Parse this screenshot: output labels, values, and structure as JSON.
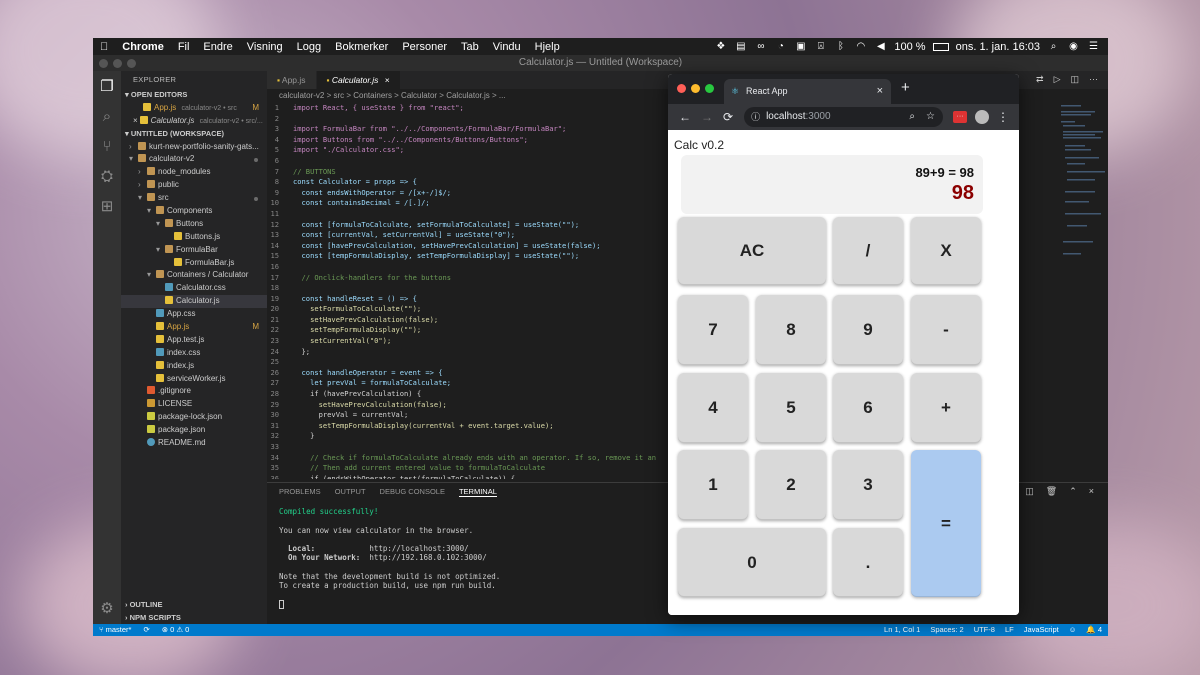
{
  "menubar": {
    "apple": "",
    "app": "Chrome",
    "items": [
      "Fil",
      "Endre",
      "Visning",
      "Logg",
      "Bokmerker",
      "Personer",
      "Tab",
      "Vindu",
      "Hjelp"
    ],
    "battery": "100 %",
    "clock": "ons. 1. jan.  16:03"
  },
  "window": {
    "title": "Calculator.js — Untitled (Workspace)"
  },
  "sidebar": {
    "title": "EXPLORER",
    "open_editors": "OPEN EDITORS",
    "open_files": [
      {
        "name": "App.js",
        "desc": "calculator-v2 • src",
        "badge": "M"
      },
      {
        "name": "Calculator.js",
        "desc": "calculator-v2 • src/..."
      }
    ],
    "workspace": "UNTITLED (WORKSPACE)",
    "tree": [
      {
        "name": "kurt-new-portfolio-sanity-gats...",
        "indent": 0,
        "icon": "folder"
      },
      {
        "name": "calculator-v2",
        "indent": 0,
        "icon": "folder-open"
      },
      {
        "name": "node_modules",
        "indent": 1,
        "icon": "folder"
      },
      {
        "name": "public",
        "indent": 1,
        "icon": "folder"
      },
      {
        "name": "src",
        "indent": 1,
        "icon": "folder-open"
      },
      {
        "name": "Components",
        "indent": 2,
        "icon": "folder-open"
      },
      {
        "name": "Buttons",
        "indent": 3,
        "icon": "folder-open"
      },
      {
        "name": "Buttons.js",
        "indent": 4,
        "icon": "js"
      },
      {
        "name": "FormulaBar",
        "indent": 3,
        "icon": "folder-open"
      },
      {
        "name": "FormulaBar.js",
        "indent": 4,
        "icon": "js"
      },
      {
        "name": "Containers / Calculator",
        "indent": 2,
        "icon": "folder-open"
      },
      {
        "name": "Calculator.css",
        "indent": 3,
        "icon": "css"
      },
      {
        "name": "Calculator.js",
        "indent": 3,
        "icon": "js"
      },
      {
        "name": "App.css",
        "indent": 2,
        "icon": "css"
      },
      {
        "name": "App.js",
        "indent": 2,
        "icon": "js",
        "badge": "M"
      },
      {
        "name": "App.test.js",
        "indent": 2,
        "icon": "js"
      },
      {
        "name": "index.css",
        "indent": 2,
        "icon": "css"
      },
      {
        "name": "index.js",
        "indent": 2,
        "icon": "js"
      },
      {
        "name": "serviceWorker.js",
        "indent": 2,
        "icon": "js"
      },
      {
        "name": ".gitignore",
        "indent": 1,
        "icon": "git"
      },
      {
        "name": "LICENSE",
        "indent": 1,
        "icon": "license"
      },
      {
        "name": "package-lock.json",
        "indent": 1,
        "icon": "json"
      },
      {
        "name": "package.json",
        "indent": 1,
        "icon": "json"
      },
      {
        "name": "README.md",
        "indent": 1,
        "icon": "info"
      }
    ],
    "outline": "OUTLINE",
    "npm": "NPM SCRIPTS"
  },
  "editor": {
    "tabs": [
      "App.js",
      "Calculator.js"
    ],
    "breadcrumb": "calculator-v2 > src > Containers > Calculator > Calculator.js > ...",
    "lines": [
      "import React, { useState } from \"react\";",
      "",
      "import FormulaBar from \"../../Components/FormulaBar/FormulaBar\";",
      "import Buttons from \"../../Components/Buttons/Buttons\";",
      "import \"./Calculator.css\";",
      "",
      "// BUTTONS",
      "const Calculator = props => {",
      "  const endsWithOperator = /[x+-/]$/;",
      "  const containsDecimal = /[.]/;",
      "",
      "  const [formulaToCalculate, setFormulaToCalculate] = useState(\"\");",
      "  const [currentVal, setCurrentVal] = useState(\"0\");",
      "  const [havePrevCalculation, setHavePrevCalculation] = useState(false);",
      "  const [tempFormulaDisplay, setTempFormulaDisplay] = useState(\"\");",
      "",
      "  // Onclick-handlers for the buttons",
      "",
      "  const handleReset = () => {",
      "    setFormulaToCalculate(\"\");",
      "    setHavePrevCalculation(false);",
      "    setTempFormulaDisplay(\"\");",
      "    setCurrentVal(\"0\");",
      "  };",
      "",
      "  const handleOperator = event => {",
      "    let prevVal = formulaToCalculate;",
      "    if (havePrevCalculation) {",
      "      setHavePrevCalculation(false);",
      "      prevVal = currentVal;",
      "      setTempFormulaDisplay(currentVal + event.target.value);",
      "    }",
      "",
      "    // Check if formulaToCalculate already ends with an operator. If so, remove it an",
      "    // Then add current entered value to formulaToCalculate",
      "    if (endsWithOperator.test(formulaToCalculate)) {"
    ]
  },
  "panel": {
    "tabs": [
      "PROBLEMS",
      "OUTPUT",
      "DEBUG CONSOLE",
      "TERMINAL"
    ],
    "terminal": {
      "compiled": "Compiled successfully!",
      "view": "You can now view calculator in the browser.",
      "local_label": "  Local:",
      "local_url": "http://localhost:3000/",
      "net_label": "  On Your Network:",
      "net_url": "http://192.168.0.102:3000/",
      "note1": "Note that the development build is not optimized.",
      "note2": "To create a production build, use npm run build."
    }
  },
  "statusbar": {
    "branch": "master*",
    "errors": "⊗ 0 ⚠ 0",
    "position": "Ln 1, Col 1",
    "spaces": "Spaces: 2",
    "encoding": "UTF-8",
    "eol": "LF",
    "language": "JavaScript",
    "notifications": "4"
  },
  "browser": {
    "tab_title": "React App",
    "url_host": "localhost",
    "url_port": ":3000",
    "app_title": "Calc v0.2",
    "formula": "89+9 = 98",
    "current": "98",
    "keys": [
      "AC",
      "/",
      "X",
      "7",
      "8",
      "9",
      "-",
      "4",
      "5",
      "6",
      "+",
      "1",
      "2",
      "3",
      "=",
      "0",
      "."
    ]
  },
  "colors": {
    "statusbar": "#007acc",
    "result": "#8b0000",
    "equals_key": "#abcaf0",
    "key": "#d9d9d9"
  }
}
